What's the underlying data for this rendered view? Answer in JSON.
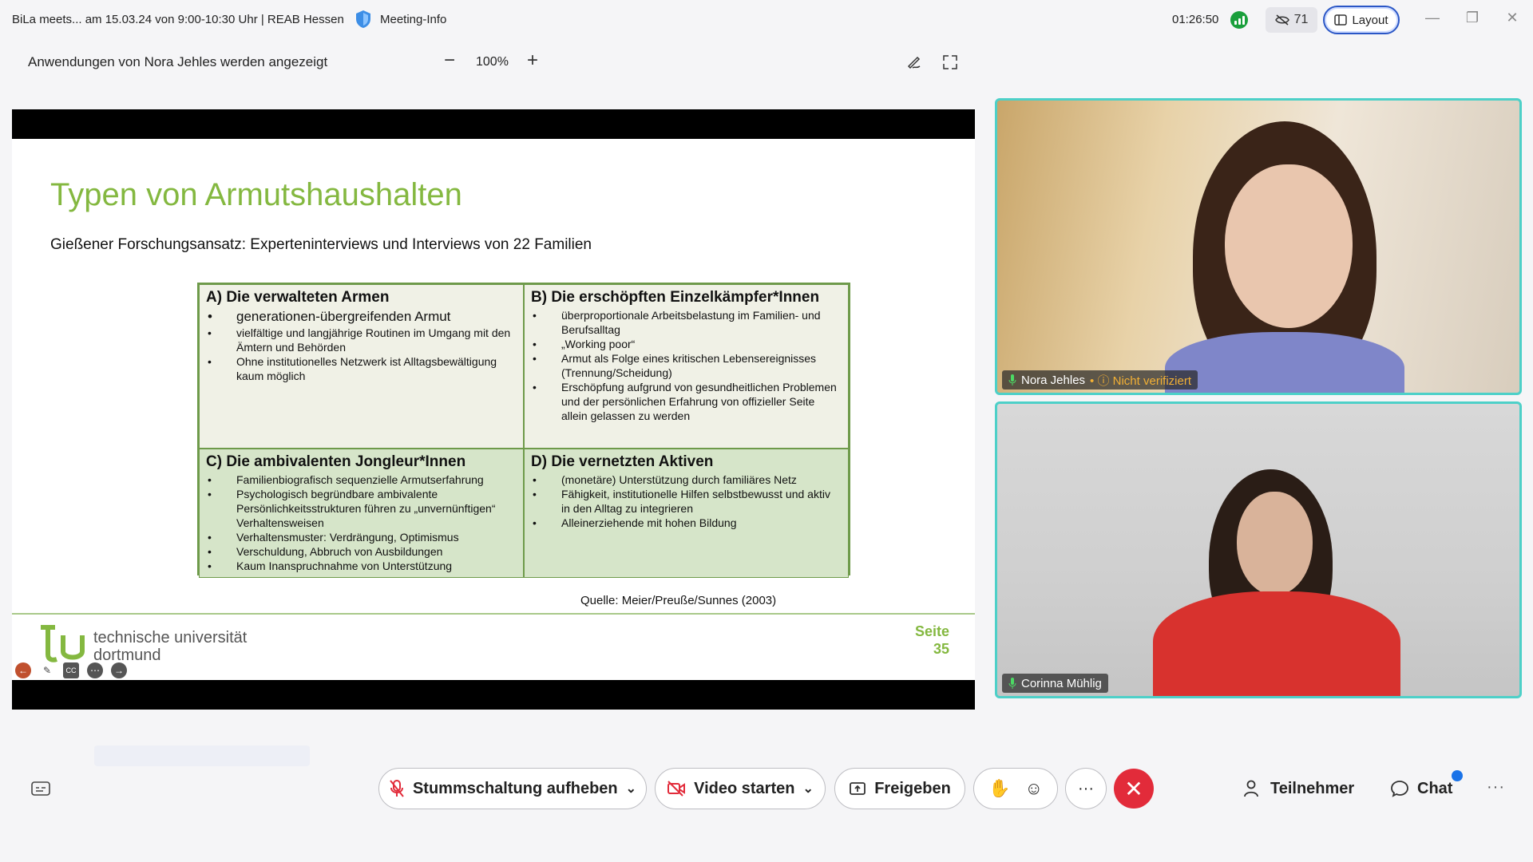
{
  "window": {
    "title": "BiLa meets... am 15.03.24 von 9:00-10:30 Uhr | REAB Hessen",
    "meeting_info": "Meeting-Info",
    "timer": "01:26:50",
    "viewers": "71",
    "layout": "Layout"
  },
  "share_bar": {
    "label": "Anwendungen von Nora Jehles werden angezeigt",
    "zoom": "100%",
    "minus": "−",
    "plus": "+"
  },
  "slide": {
    "title": "Typen von Armutshaushalten",
    "subtitle": "Gießener Forschungsansatz: Experteninterviews und Interviews von 22 Familien",
    "cells": [
      {
        "heading": "A)   Die verwalteten Armen",
        "items": [
          "generationen-übergreifenden Armut",
          "vielfältige und langjährige Routinen im Umgang mit den Ämtern und Behörden",
          "Ohne institutionelles Netzwerk ist Alltagsbewältigung kaum möglich"
        ]
      },
      {
        "heading": "B) Die erschöpften Einzelkämpfer*Innen",
        "items": [
          "überproportionale Arbeitsbelastung im Familien- und Berufsalltag",
          "„Working poor“",
          "Armut als Folge eines kritischen Lebensereignisses (Trennung/Scheidung)",
          "Erschöpfung aufgrund von gesundheitlichen Problemen und der persönlichen Erfahrung von offizieller Seite allein gelassen zu werden"
        ]
      },
      {
        "heading": "C) Die ambivalenten Jongleur*Innen",
        "items": [
          "Familienbiografisch sequenzielle Armutserfahrung",
          "Psychologisch begründbare ambivalente Persönlichkeitsstrukturen führen zu „unvernünftigen“ Verhaltensweisen",
          "Verhaltensmuster: Verdrängung, Optimismus",
          "Verschuldung, Abbruch von Ausbildungen",
          "Kaum Inanspruchnahme von Unterstützung"
        ]
      },
      {
        "heading": "D) Die vernetzten Aktiven",
        "items": [
          "(monetäre) Unterstützung durch familiäres Netz",
          "Fähigkeit, institutionelle Hilfen selbstbewusst und aktiv in den Alltag zu integrieren",
          "Alleinerziehende mit hohen Bildung"
        ]
      }
    ],
    "source": "Quelle: Meier/Preuße/Sunnes (2003)",
    "university_line1": "technische universität",
    "university_line2": "dortmund",
    "page_label": "Seite",
    "page_number": "35"
  },
  "participants": [
    {
      "name": "Nora Jehles",
      "status": "Nicht verifiziert"
    },
    {
      "name": "Corinna Mühlig"
    }
  ],
  "controls": {
    "unmute": "Stummschaltung aufheben",
    "video": "Video starten",
    "share": "Freigeben",
    "more": "···",
    "participants": "Teilnehmer",
    "chat": "Chat"
  },
  "colors": {
    "accent": "#2a56c6",
    "slide_green": "#84b840",
    "end_red": "#e22b3a",
    "active_border": "#4dd0c8"
  }
}
